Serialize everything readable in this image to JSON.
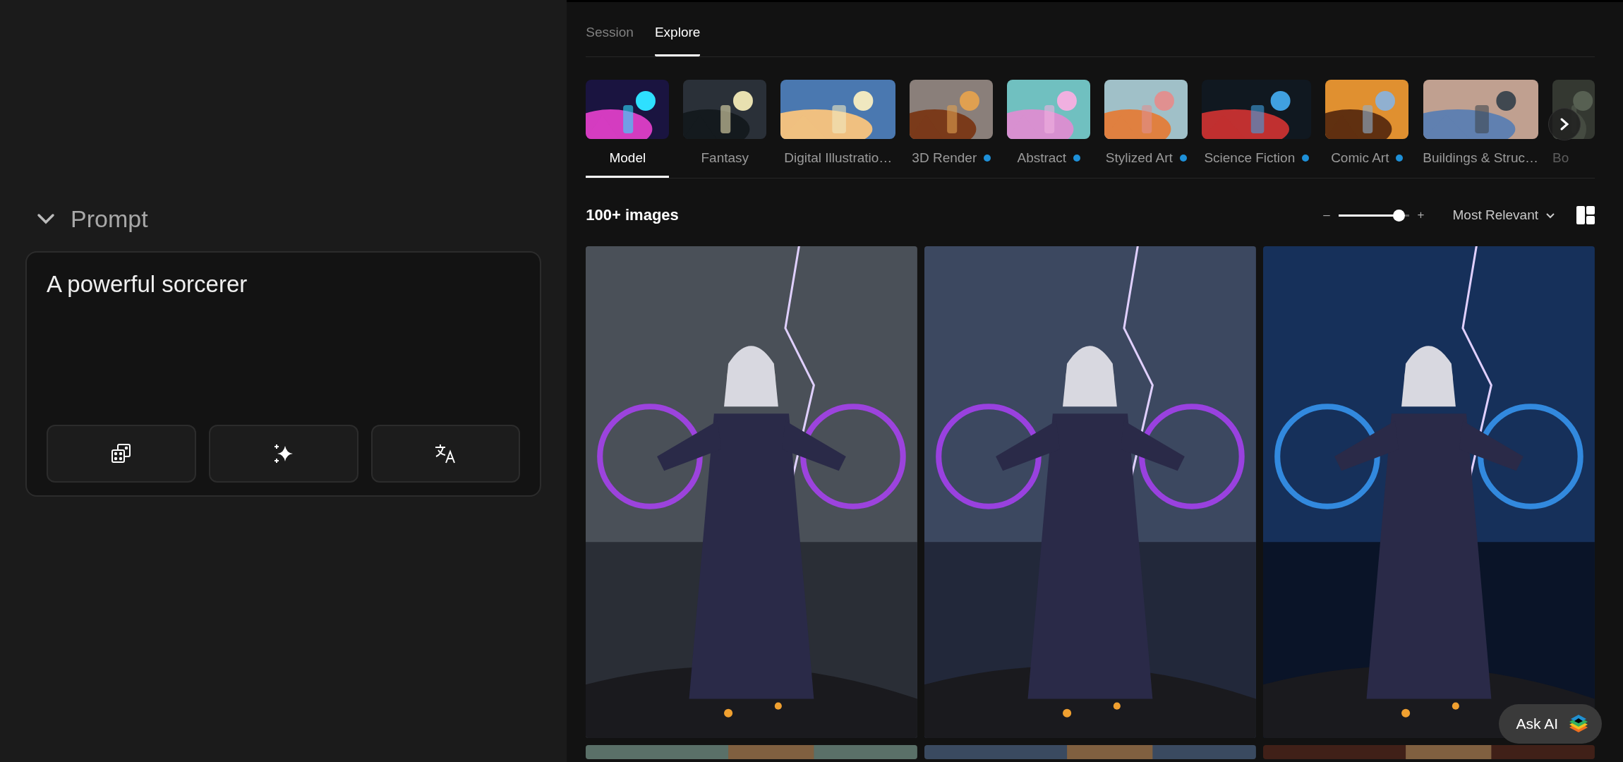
{
  "prompt_panel": {
    "title": "Prompt",
    "expanded": true,
    "value": "A powerful sorcerer"
  },
  "tabs": [
    {
      "label": "Session",
      "selected": false
    },
    {
      "label": "Explore",
      "selected": true
    }
  ],
  "categories": [
    {
      "label": "Model",
      "selected": true,
      "marked": false
    },
    {
      "label": "Fantasy",
      "selected": false,
      "marked": false
    },
    {
      "label": "Digital Illustratio…",
      "selected": false,
      "marked": false
    },
    {
      "label": "3D Render",
      "selected": false,
      "marked": true
    },
    {
      "label": "Abstract",
      "selected": false,
      "marked": true
    },
    {
      "label": "Stylized Art",
      "selected": false,
      "marked": true
    },
    {
      "label": "Science Fiction",
      "selected": false,
      "marked": true
    },
    {
      "label": "Comic Art",
      "selected": false,
      "marked": true
    },
    {
      "label": "Buildings & Struc…",
      "selected": false,
      "marked": false
    },
    {
      "label": "Bo",
      "selected": false,
      "marked": false
    }
  ],
  "toolbar": {
    "count": "100+ images",
    "zoom_minus": "–",
    "zoom_plus": "+",
    "zoom": {
      "level": 0.85
    },
    "sort": "Most Relevant"
  },
  "ask_ai": {
    "label": "Ask AI"
  }
}
